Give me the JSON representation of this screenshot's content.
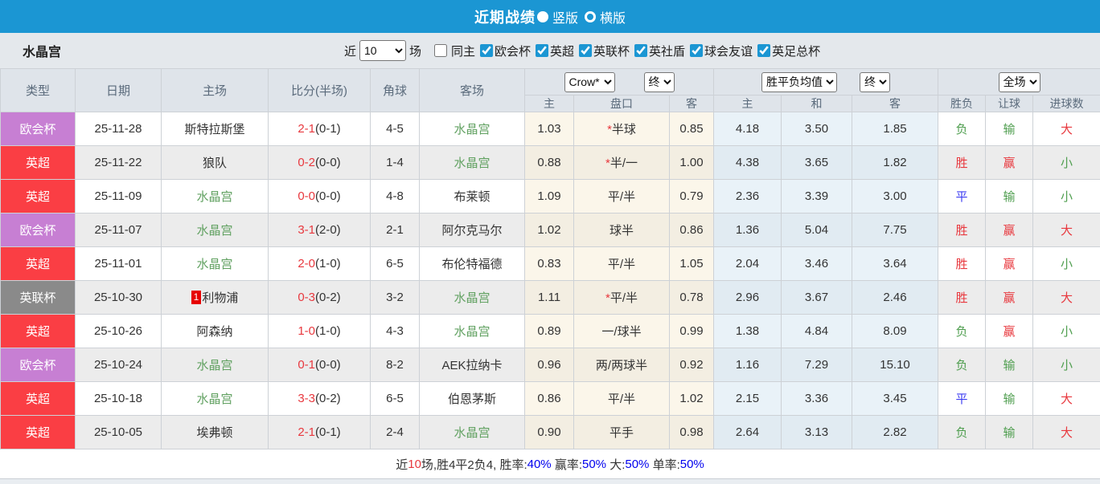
{
  "colors": {
    "accent_blue": "#1b96d3",
    "filter_bg": "#e4e8ec",
    "header_bg": "#dfe4ea",
    "row_alt_bg": "#ececec",
    "cream_bg": "#fbf6ea",
    "cream_alt_bg": "#f3eee2",
    "blue_bg": "#e9f2f8",
    "blue_alt_bg": "#e1ebf2",
    "red": "#e8383e",
    "green": "#4f9e4f",
    "blue": "#3d3df2",
    "team_green": "#61a161",
    "link_blue": "#0000ee",
    "sup_red": "#e60000",
    "badge_purple": "#c77fd3",
    "badge_red": "#fa3e44",
    "badge_gray": "#8a8a8a"
  },
  "titlebar": {
    "title": "近期战绩",
    "options": [
      {
        "label": "竖版",
        "selected": true
      },
      {
        "label": "横版",
        "selected": false
      }
    ]
  },
  "filters": {
    "team_name": "水晶宫",
    "prefix_label": "近",
    "count_value": "10",
    "suffix_label": "场",
    "checkboxes": [
      {
        "label": "同主",
        "checked": false
      },
      {
        "label": "欧会杯",
        "checked": true
      },
      {
        "label": "英超",
        "checked": true
      },
      {
        "label": "英联杯",
        "checked": true
      },
      {
        "label": "英社盾",
        "checked": true
      },
      {
        "label": "球会友谊",
        "checked": true
      },
      {
        "label": "英足总杯",
        "checked": true
      }
    ]
  },
  "table": {
    "columns": [
      "类型",
      "日期",
      "主场",
      "比分(半场)",
      "角球",
      "客场"
    ],
    "sub_columns": [
      "主",
      "盘口",
      "客",
      "主",
      "和",
      "客",
      "胜负",
      "让球",
      "进球数"
    ],
    "selects": {
      "odds_source": "Crow*",
      "odds_time": "终",
      "avg_label": "胜平负均值",
      "avg_time": "终",
      "scope": "全场"
    },
    "rows": [
      {
        "type": "欧会杯",
        "type_color": "purple",
        "date": "25-11-28",
        "home": "斯特拉斯堡",
        "home_color": "dark",
        "home_sup": "",
        "score": "2-1",
        "half": "(0-1)",
        "corners": "4-5",
        "away": "水晶宫",
        "away_color": "green",
        "crow_home": "1.03",
        "handicap_prefix": "*",
        "handicap": "半球",
        "crow_away": "0.85",
        "avg_home": "4.18",
        "avg_draw": "3.50",
        "avg_away": "1.85",
        "result": {
          "text": "负",
          "color": "green"
        },
        "spread": {
          "text": "输",
          "color": "green"
        },
        "goals": {
          "text": "大",
          "color": "red"
        }
      },
      {
        "type": "英超",
        "type_color": "red",
        "date": "25-11-22",
        "home": "狼队",
        "home_color": "dark",
        "home_sup": "",
        "score": "0-2",
        "half": "(0-0)",
        "corners": "1-4",
        "away": "水晶宫",
        "away_color": "green",
        "crow_home": "0.88",
        "handicap_prefix": "*",
        "handicap": "半/一",
        "crow_away": "1.00",
        "avg_home": "4.38",
        "avg_draw": "3.65",
        "avg_away": "1.82",
        "result": {
          "text": "胜",
          "color": "red"
        },
        "spread": {
          "text": "赢",
          "color": "red"
        },
        "goals": {
          "text": "小",
          "color": "green"
        }
      },
      {
        "type": "英超",
        "type_color": "red",
        "date": "25-11-09",
        "home": "水晶宫",
        "home_color": "green",
        "home_sup": "",
        "score": "0-0",
        "half": "(0-0)",
        "corners": "4-8",
        "away": "布莱顿",
        "away_color": "dark",
        "crow_home": "1.09",
        "handicap_prefix": "",
        "handicap": "平/半",
        "crow_away": "0.79",
        "avg_home": "2.36",
        "avg_draw": "3.39",
        "avg_away": "3.00",
        "result": {
          "text": "平",
          "color": "blue"
        },
        "spread": {
          "text": "输",
          "color": "green"
        },
        "goals": {
          "text": "小",
          "color": "green"
        }
      },
      {
        "type": "欧会杯",
        "type_color": "purple",
        "date": "25-11-07",
        "home": "水晶宫",
        "home_color": "green",
        "home_sup": "",
        "score": "3-1",
        "half": "(2-0)",
        "corners": "2-1",
        "away": "阿尔克马尔",
        "away_color": "dark",
        "crow_home": "1.02",
        "handicap_prefix": "",
        "handicap": "球半",
        "crow_away": "0.86",
        "avg_home": "1.36",
        "avg_draw": "5.04",
        "avg_away": "7.75",
        "result": {
          "text": "胜",
          "color": "red"
        },
        "spread": {
          "text": "赢",
          "color": "red"
        },
        "goals": {
          "text": "大",
          "color": "red"
        }
      },
      {
        "type": "英超",
        "type_color": "red",
        "date": "25-11-01",
        "home": "水晶宫",
        "home_color": "green",
        "home_sup": "",
        "score": "2-0",
        "half": "(1-0)",
        "corners": "6-5",
        "away": "布伦特福德",
        "away_color": "dark",
        "crow_home": "0.83",
        "handicap_prefix": "",
        "handicap": "平/半",
        "crow_away": "1.05",
        "avg_home": "2.04",
        "avg_draw": "3.46",
        "avg_away": "3.64",
        "result": {
          "text": "胜",
          "color": "red"
        },
        "spread": {
          "text": "赢",
          "color": "red"
        },
        "goals": {
          "text": "小",
          "color": "green"
        }
      },
      {
        "type": "英联杯",
        "type_color": "gray",
        "date": "25-10-30",
        "home": "利物浦",
        "home_color": "dark",
        "home_sup": "1",
        "score": "0-3",
        "half": "(0-2)",
        "corners": "3-2",
        "away": "水晶宫",
        "away_color": "green",
        "crow_home": "1.11",
        "handicap_prefix": "*",
        "handicap": "平/半",
        "crow_away": "0.78",
        "avg_home": "2.96",
        "avg_draw": "3.67",
        "avg_away": "2.46",
        "result": {
          "text": "胜",
          "color": "red"
        },
        "spread": {
          "text": "赢",
          "color": "red"
        },
        "goals": {
          "text": "大",
          "color": "red"
        }
      },
      {
        "type": "英超",
        "type_color": "red",
        "date": "25-10-26",
        "home": "阿森纳",
        "home_color": "dark",
        "home_sup": "",
        "score": "1-0",
        "half": "(1-0)",
        "corners": "4-3",
        "away": "水晶宫",
        "away_color": "green",
        "crow_home": "0.89",
        "handicap_prefix": "",
        "handicap": "一/球半",
        "crow_away": "0.99",
        "avg_home": "1.38",
        "avg_draw": "4.84",
        "avg_away": "8.09",
        "result": {
          "text": "负",
          "color": "green"
        },
        "spread": {
          "text": "赢",
          "color": "red"
        },
        "goals": {
          "text": "小",
          "color": "green"
        }
      },
      {
        "type": "欧会杯",
        "type_color": "purple",
        "date": "25-10-24",
        "home": "水晶宫",
        "home_color": "green",
        "home_sup": "",
        "score": "0-1",
        "half": "(0-0)",
        "corners": "8-2",
        "away": "AEK拉纳卡",
        "away_color": "dark",
        "crow_home": "0.96",
        "handicap_prefix": "",
        "handicap": "两/两球半",
        "crow_away": "0.92",
        "avg_home": "1.16",
        "avg_draw": "7.29",
        "avg_away": "15.10",
        "result": {
          "text": "负",
          "color": "green"
        },
        "spread": {
          "text": "输",
          "color": "green"
        },
        "goals": {
          "text": "小",
          "color": "green"
        }
      },
      {
        "type": "英超",
        "type_color": "red",
        "date": "25-10-18",
        "home": "水晶宫",
        "home_color": "green",
        "home_sup": "",
        "score": "3-3",
        "half": "(0-2)",
        "corners": "6-5",
        "away": "伯恩茅斯",
        "away_color": "dark",
        "crow_home": "0.86",
        "handicap_prefix": "",
        "handicap": "平/半",
        "crow_away": "1.02",
        "avg_home": "2.15",
        "avg_draw": "3.36",
        "avg_away": "3.45",
        "result": {
          "text": "平",
          "color": "blue"
        },
        "spread": {
          "text": "输",
          "color": "green"
        },
        "goals": {
          "text": "大",
          "color": "red"
        }
      },
      {
        "type": "英超",
        "type_color": "red",
        "date": "25-10-05",
        "home": "埃弗顿",
        "home_color": "dark",
        "home_sup": "",
        "score": "2-1",
        "half": "(0-1)",
        "corners": "2-4",
        "away": "水晶宫",
        "away_color": "green",
        "crow_home": "0.90",
        "handicap_prefix": "",
        "handicap": "平手",
        "crow_away": "0.98",
        "avg_home": "2.64",
        "avg_draw": "3.13",
        "avg_away": "2.82",
        "result": {
          "text": "负",
          "color": "green"
        },
        "spread": {
          "text": "输",
          "color": "green"
        },
        "goals": {
          "text": "大",
          "color": "red"
        }
      }
    ]
  },
  "footer": {
    "parts": [
      {
        "text": "近",
        "color": "dark"
      },
      {
        "text": "10",
        "color": "red"
      },
      {
        "text": "场,胜4平2负4, 胜率:",
        "color": "dark"
      },
      {
        "text": "40%",
        "color": "linkblue"
      },
      {
        "text": " 赢率:",
        "color": "dark"
      },
      {
        "text": "50%",
        "color": "linkblue"
      },
      {
        "text": " 大:",
        "color": "dark"
      },
      {
        "text": "50%",
        "color": "linkblue"
      },
      {
        "text": " 单率:",
        "color": "dark"
      },
      {
        "text": "50%",
        "color": "linkblue"
      }
    ]
  }
}
